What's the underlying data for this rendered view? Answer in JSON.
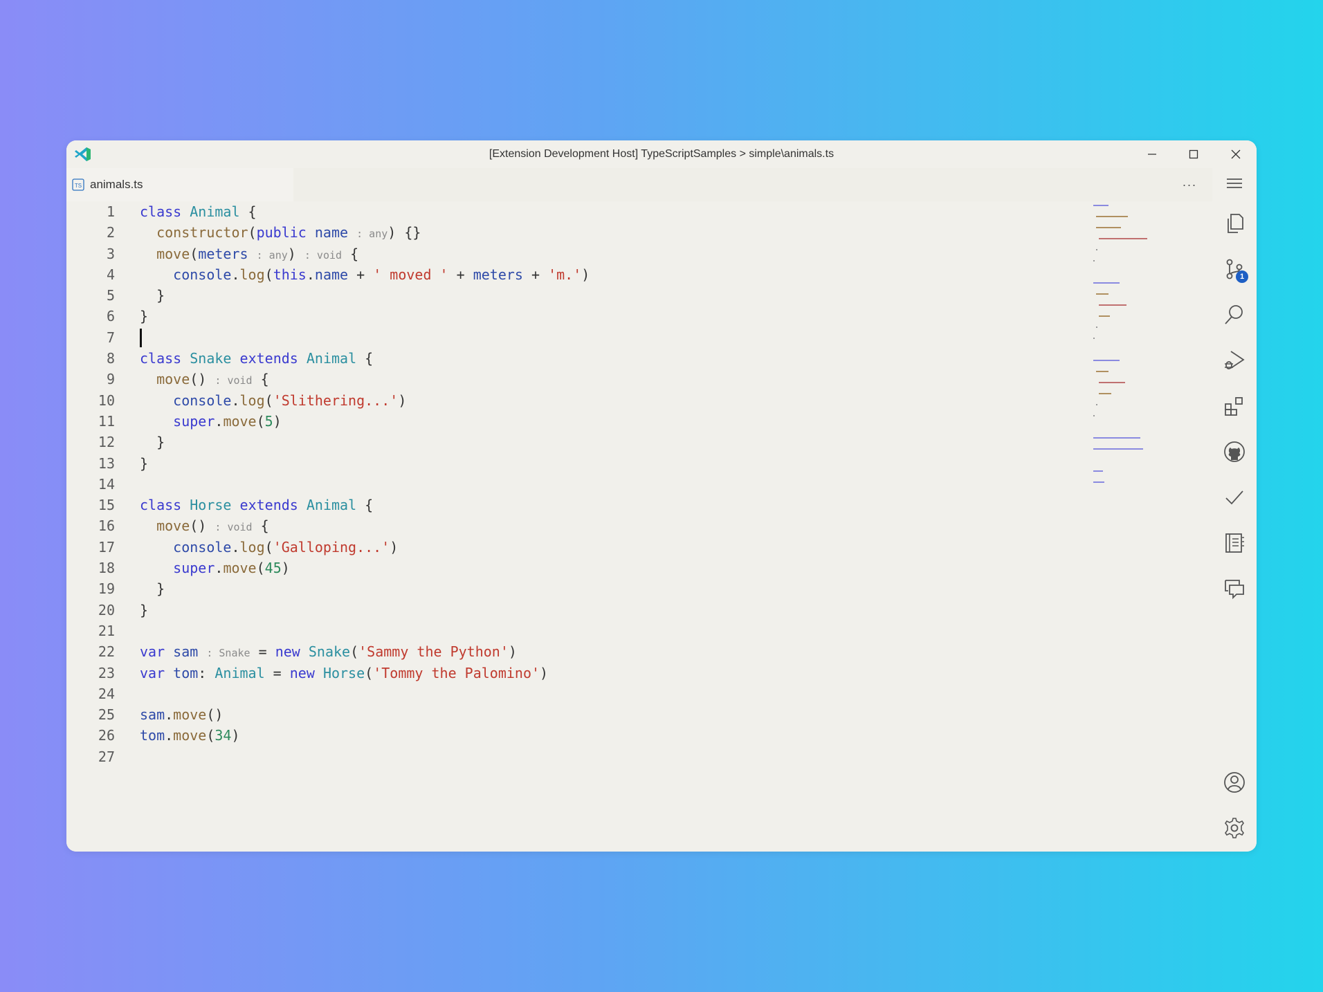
{
  "window": {
    "title": "[Extension Development Host] TypeScriptSamples > simple\\animals.ts"
  },
  "tab": {
    "label": "animals.ts",
    "icon": "typescript-file-icon"
  },
  "editor": {
    "more_label": "···",
    "cursor_line": 7,
    "lines": [
      {
        "n": "1"
      },
      {
        "n": "2"
      },
      {
        "n": "3"
      },
      {
        "n": "4"
      },
      {
        "n": "5"
      },
      {
        "n": "6"
      },
      {
        "n": "7"
      },
      {
        "n": "8"
      },
      {
        "n": "9"
      },
      {
        "n": "10"
      },
      {
        "n": "11"
      },
      {
        "n": "12"
      },
      {
        "n": "13"
      },
      {
        "n": "14"
      },
      {
        "n": "15"
      },
      {
        "n": "16"
      },
      {
        "n": "17"
      },
      {
        "n": "18"
      },
      {
        "n": "19"
      },
      {
        "n": "20"
      },
      {
        "n": "21"
      },
      {
        "n": "22"
      },
      {
        "n": "23"
      },
      {
        "n": "24"
      },
      {
        "n": "25"
      },
      {
        "n": "26"
      },
      {
        "n": "27"
      }
    ],
    "tokens": {
      "l1_kw": "class",
      "l1_cls": "Animal",
      "l1_rest": " {",
      "l2_fn": "constructor",
      "l2_p1": "(",
      "l2_kw": "public",
      "l2_var": "name",
      "l2_hint": ": any",
      "l2_rest": ") {}",
      "l3_fn": "move",
      "l3_p1": "(",
      "l3_var": "meters",
      "l3_hint1": ": any",
      "l3_p2": ")",
      "l3_hint2": ": void",
      "l3_rest": " {",
      "l4_var1": "console",
      "l4_dot1": ".",
      "l4_fn": "log",
      "l4_p1": "(",
      "l4_kw": "this",
      "l4_dot2": ".",
      "l4_var2": "name",
      "l4_op1": " + ",
      "l4_str1": "' moved '",
      "l4_op2": " + ",
      "l4_var3": "meters",
      "l4_op3": " + ",
      "l4_str2": "'m.'",
      "l4_p2": ")",
      "l5": "}",
      "l6": "}",
      "l8_kw1": "class",
      "l8_cls1": "Snake",
      "l8_kw2": "extends",
      "l8_cls2": "Animal",
      "l8_rest": " {",
      "l9_fn": "move",
      "l9_p": "()",
      "l9_hint": ": void",
      "l9_rest": " {",
      "l10_var": "console",
      "l10_dot": ".",
      "l10_fn": "log",
      "l10_p1": "(",
      "l10_str": "'Slithering...'",
      "l10_p2": ")",
      "l11_kw": "super",
      "l11_dot": ".",
      "l11_fn": "move",
      "l11_p1": "(",
      "l11_num": "5",
      "l11_p2": ")",
      "l12": "}",
      "l13": "}",
      "l15_kw1": "class",
      "l15_cls1": "Horse",
      "l15_kw2": "extends",
      "l15_cls2": "Animal",
      "l15_rest": " {",
      "l16_fn": "move",
      "l16_p": "()",
      "l16_hint": ": void",
      "l16_rest": " {",
      "l17_var": "console",
      "l17_dot": ".",
      "l17_fn": "log",
      "l17_p1": "(",
      "l17_str": "'Galloping...'",
      "l17_p2": ")",
      "l18_kw": "super",
      "l18_dot": ".",
      "l18_fn": "move",
      "l18_p1": "(",
      "l18_num": "45",
      "l18_p2": ")",
      "l19": "}",
      "l20": "}",
      "l22_kw1": "var",
      "l22_var": "sam",
      "l22_hint": ": Snake",
      "l22_op": " = ",
      "l22_kw2": "new",
      "l22_cls": "Snake",
      "l22_p1": "(",
      "l22_str": "'Sammy the Python'",
      "l22_p2": ")",
      "l23_kw1": "var",
      "l23_var": "tom",
      "l23_colon": ": ",
      "l23_cls1": "Animal",
      "l23_op": " = ",
      "l23_kw2": "new",
      "l23_cls2": "Horse",
      "l23_p1": "(",
      "l23_str": "'Tommy the Palomino'",
      "l23_p2": ")",
      "l25_var": "sam",
      "l25_dot": ".",
      "l25_fn": "move",
      "l25_p": "()",
      "l26_var": "tom",
      "l26_dot": ".",
      "l26_fn": "move",
      "l26_p1": "(",
      "l26_num": "34",
      "l26_p2": ")"
    }
  },
  "activity_bar": {
    "scm_badge": "1",
    "items": [
      "menu-icon",
      "explorer-icon",
      "source-control-icon",
      "search-icon",
      "run-debug-icon",
      "extensions-icon",
      "github-icon",
      "checkmark-icon",
      "notebook-icon",
      "comments-icon",
      "account-icon",
      "settings-gear-icon"
    ]
  },
  "colors": {
    "keyword": "#3a3acf",
    "class": "#2b8fa0",
    "function": "#8a6a3a",
    "string": "#c03a2e",
    "number": "#2d8a5c",
    "variable": "#2e4aa8",
    "badge": "#1e5fc4"
  }
}
